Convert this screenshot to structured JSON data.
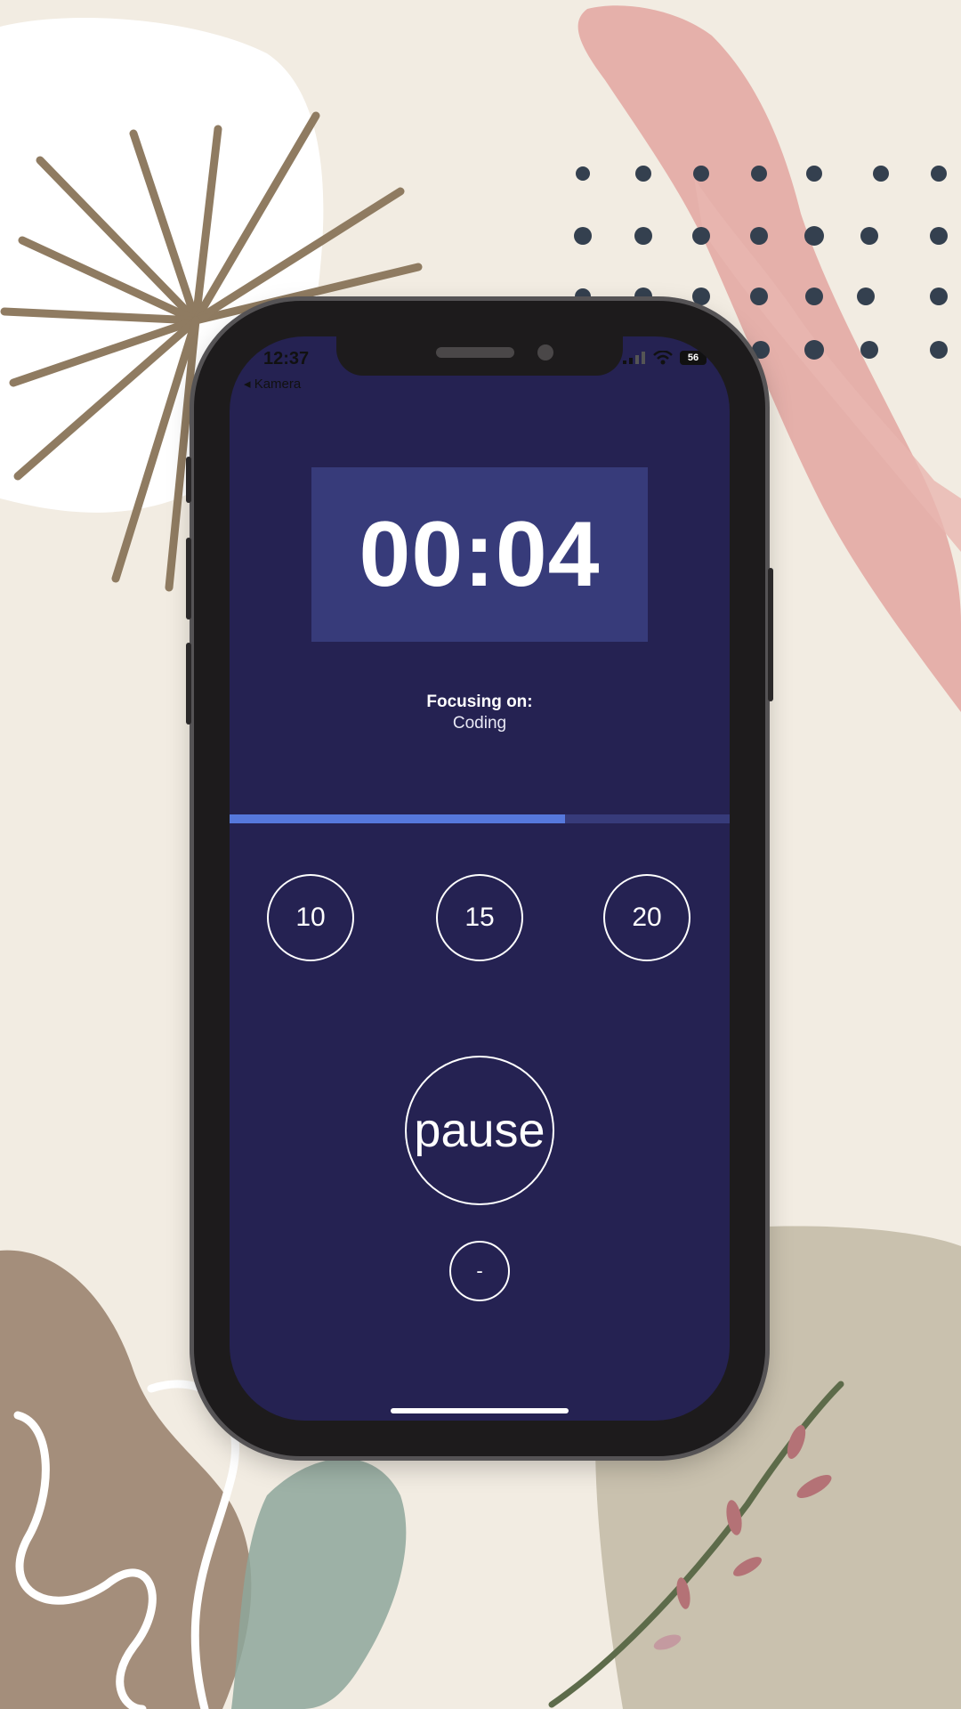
{
  "status_bar": {
    "time": "12:37",
    "back_label": "◂ Kamera",
    "battery": "56"
  },
  "timer": {
    "display": "00:04"
  },
  "focus": {
    "label": "Focusing on:",
    "value": "Coding"
  },
  "progress": {
    "fraction": 0.67
  },
  "presets": [
    {
      "label": "10"
    },
    {
      "label": "15"
    },
    {
      "label": "20"
    }
  ],
  "controls": {
    "pause_label": "pause",
    "minus_label": "-"
  },
  "colors": {
    "screen_bg": "#252252",
    "timer_box": "#373b7a",
    "progress_fill": "#5678dc",
    "progress_track": "#373b7a",
    "page_bg": "#f2ece2"
  },
  "icons": [
    "signal-icon",
    "wifi-icon",
    "battery-icon"
  ]
}
